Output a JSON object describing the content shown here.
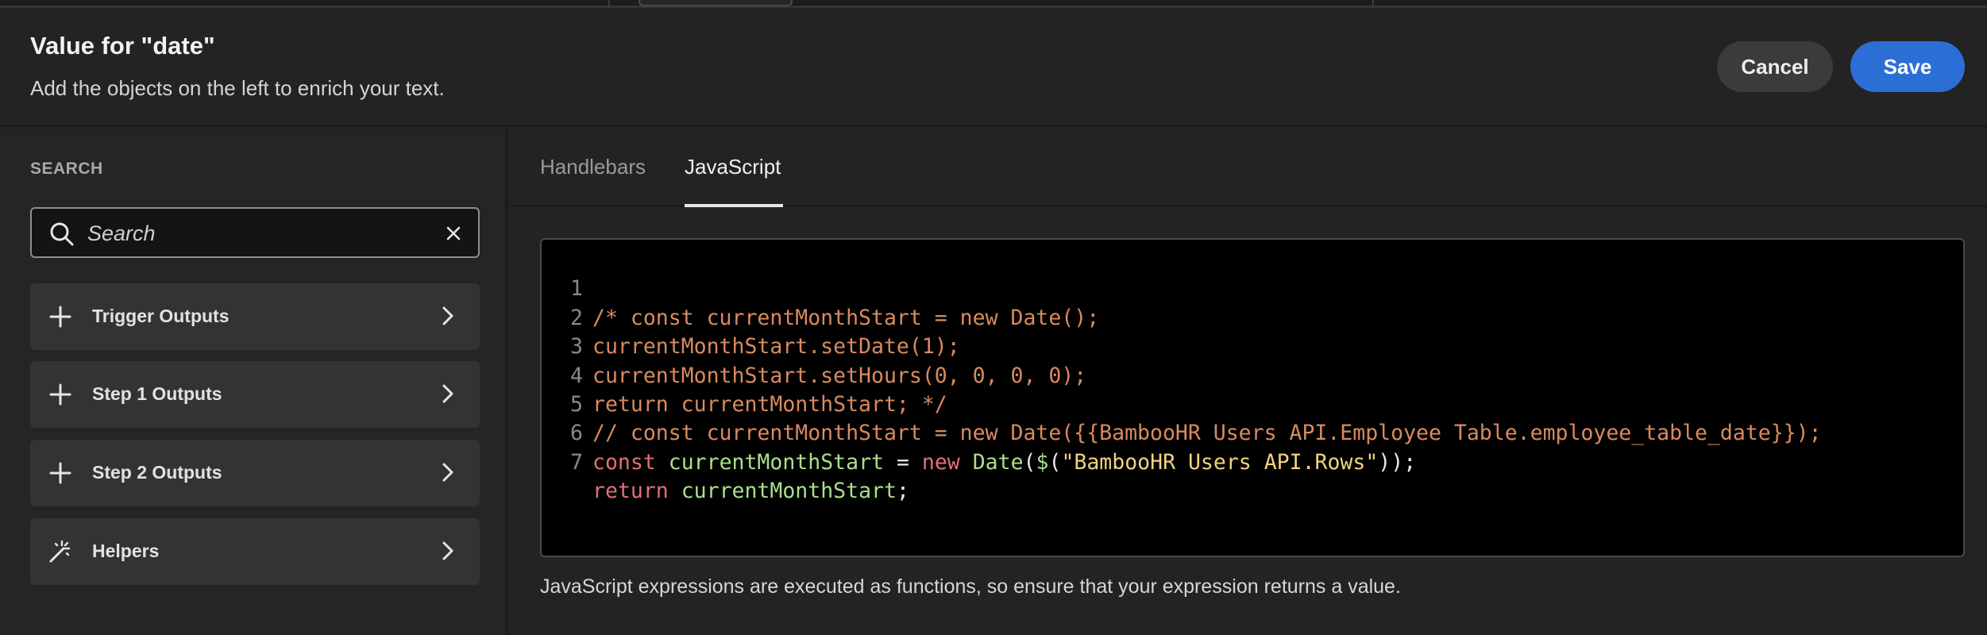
{
  "header": {
    "title": "Value for \"date\"",
    "subtitle": "Add the objects on the left to enrich your text.",
    "cancel_label": "Cancel",
    "save_label": "Save"
  },
  "sidebar": {
    "section_label": "SEARCH",
    "search": {
      "placeholder": "Search",
      "value": ""
    },
    "items": [
      {
        "label": "Trigger Outputs",
        "icon": "plus-icon"
      },
      {
        "label": "Step 1 Outputs",
        "icon": "plus-icon"
      },
      {
        "label": "Step 2 Outputs",
        "icon": "plus-icon"
      },
      {
        "label": "Helpers",
        "icon": "magic-wand-icon"
      }
    ]
  },
  "tabs": [
    {
      "label": "Handlebars",
      "active": false
    },
    {
      "label": "JavaScript",
      "active": true
    }
  ],
  "editor": {
    "line_numbers": [
      "1",
      "2",
      "3",
      "4",
      "5",
      "6",
      "7"
    ],
    "lines": {
      "l1": "/* const currentMonthStart = new Date();",
      "l2": "currentMonthStart.setDate(1);",
      "l3": "currentMonthStart.setHours(0, 0, 0, 0);",
      "l4": "return currentMonthStart; */",
      "l5": "// const currentMonthStart = new Date({{BambooHR Users API.Employee Table.employee_table_date}});",
      "l6": {
        "kw_const": "const",
        "ident": "currentMonthStart",
        "op_assign": " = ",
        "kw_new": "new",
        "fn_date": "Date",
        "punc_open": "(",
        "fn_dollar": "$",
        "punc_open2": "(",
        "str": "\"BambooHR Users API.Rows\"",
        "punc_close": "));"
      },
      "l7": {
        "kw_return": "return",
        "ident": "currentMonthStart",
        "punc": ";"
      }
    }
  },
  "hint": "JavaScript expressions are executed as functions, so ensure that your expression returns a value.",
  "colors": {
    "save_button": "#2b6fd6",
    "comment": "#d98a5f",
    "keyword": "#e26f78",
    "identifier": "#a9e08a",
    "string": "#f1d37a"
  }
}
